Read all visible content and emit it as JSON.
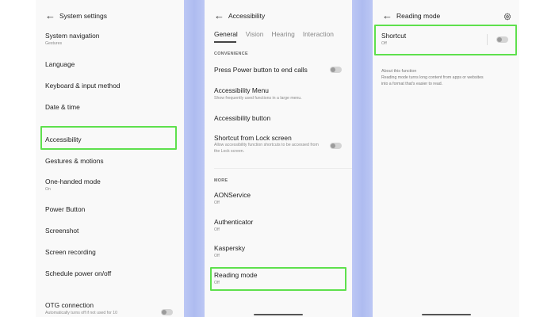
{
  "panel1": {
    "title": "System settings",
    "items": [
      {
        "label": "System navigation",
        "sub": "Gestures"
      },
      {
        "label": "Language"
      },
      {
        "label": "Keyboard & input method"
      },
      {
        "label": "Date & time"
      },
      {
        "label": "Accessibility"
      },
      {
        "label": "Gestures & motions"
      },
      {
        "label": "One-handed mode",
        "sub": "On"
      },
      {
        "label": "Power Button"
      },
      {
        "label": "Screenshot"
      },
      {
        "label": "Screen recording"
      },
      {
        "label": "Schedule power on/off"
      },
      {
        "label": "OTG connection",
        "sub": "Automatically turns off if not used for 10"
      }
    ]
  },
  "panel2": {
    "title": "Accessibility",
    "tabs": [
      "General",
      "Vision",
      "Hearing",
      "Interaction"
    ],
    "section_convenience": "CONVENIENCE",
    "section_more": "MORE",
    "items": [
      {
        "label": "Press Power button to end calls"
      },
      {
        "label": "Accessibility Menu",
        "sub": "Show frequently used functions in a large menu."
      },
      {
        "label": "Accessibility button"
      },
      {
        "label": "Shortcut from Lock screen",
        "sub": "Allow accessibility function shortcuts to be accessed from the Lock screen."
      },
      {
        "label": "AONService",
        "sub": "Off"
      },
      {
        "label": "Authenticator",
        "sub": "Off"
      },
      {
        "label": "Kaspersky",
        "sub": "Off"
      },
      {
        "label": "Reading mode",
        "sub": "Off"
      }
    ]
  },
  "panel3": {
    "title": "Reading mode",
    "shortcut": {
      "label": "Shortcut",
      "sub": "Off"
    },
    "about_title": "About this function",
    "about_text": "Reading mode turns long content from apps or websites into a format that's easier to read."
  },
  "icons": {
    "back": "arrow-left-icon",
    "settings": "gear-icon"
  },
  "colors": {
    "highlight": "#5ee04d",
    "gap": "#aebcf0"
  }
}
